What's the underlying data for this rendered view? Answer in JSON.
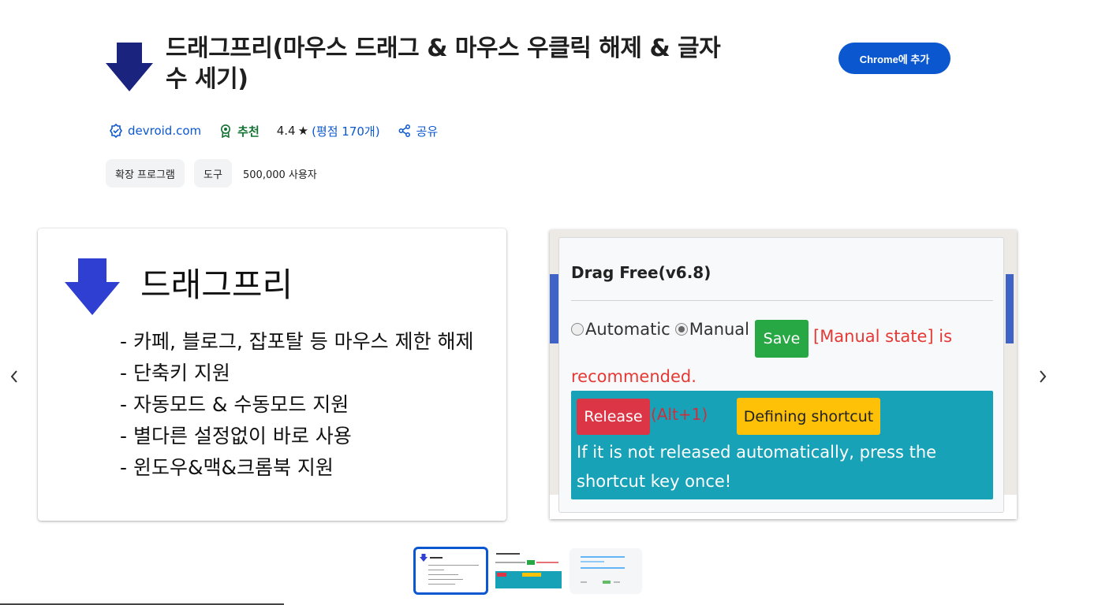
{
  "header": {
    "title": "드래그프리(마우스 드래그 & 마우스 우클릭 해제 & 글자수 세기)",
    "add_button": "Chrome에 추가"
  },
  "meta": {
    "developer": "devroid.com",
    "featured": "추천",
    "rating": "4.4",
    "rating_star": "★",
    "rating_count": "(평점 170개)",
    "share": "공유"
  },
  "chips": [
    "확장 프로그램",
    "도구"
  ],
  "users": "500,000 사용자",
  "slide1": {
    "title": "드래그프리",
    "features": [
      "- 카페, 블로그, 잡포탈 등 마우스 제한 해제",
      "- 단축키 지원",
      "- 자동모드 & 수동모드 지원",
      "- 별다른 설정없이 바로 사용",
      "- 윈도우&맥&크롬북 지원"
    ]
  },
  "slide2": {
    "popup_title": "Drag Free(v6.8)",
    "automatic": "Automatic",
    "manual": "Manual",
    "save": "Save",
    "manual_note": "[Manual state] is",
    "recommended": "recommended.",
    "release": "Release",
    "alt": "(Alt+1)",
    "defining": "Defining shortcut",
    "note": "If it is not released automatically, press the shortcut key once!"
  },
  "colors": {
    "accent": "#0b57d0",
    "featured": "#137333",
    "logo_navy": "#1a237e",
    "slide_arrow": "#2f3fd1",
    "save_green": "#28a745",
    "release_red": "#dc3545",
    "teal": "#17a2b8",
    "define_yellow": "#ffc107"
  },
  "icons": {
    "verified": "verified-badge-icon",
    "featured": "award-icon",
    "share": "share-icon",
    "prev": "chevron-left-icon",
    "next": "chevron-right-icon"
  }
}
